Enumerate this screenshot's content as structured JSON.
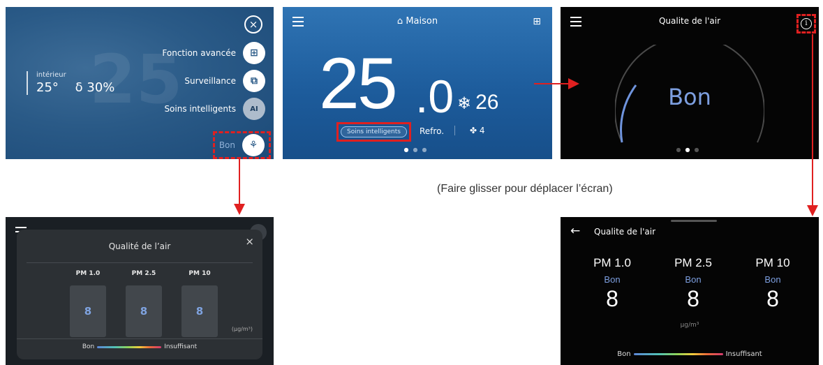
{
  "caption": "(Faire glisser pour déplacer l’écran)",
  "colors": {
    "annotation_red": "#e02020",
    "quality_blue": "#7d9fe0",
    "home_blue": "#1d5c9c"
  },
  "menu_screen": {
    "close_icon": "close-icon",
    "indoor_label": "intérieur",
    "indoor_values": "25°  δ 30%",
    "items": [
      {
        "label": "Fonction avancée",
        "icon": "grid-icon",
        "glyph": "⊞"
      },
      {
        "label": "Surveillance",
        "icon": "monitor-icon",
        "glyph": "⧉"
      },
      {
        "label": "Soins intelligents",
        "icon": "ai-icon",
        "glyph": "AI"
      },
      {
        "label": "Bon",
        "icon": "tree-icon",
        "glyph": "⚘"
      }
    ]
  },
  "home_screen": {
    "title": "Maison",
    "home_glyph": "⌂",
    "grid_glyph": "⊞",
    "temp_int": "25",
    "temp_dec": ".0",
    "set_glyph": "❄",
    "set_temp": "26",
    "smart_chip": "Soins intelligents",
    "mode": "Refro.",
    "fan_glyph": "✤",
    "fan_speed": "4"
  },
  "gauge_screen": {
    "title": "Qualite de l'air",
    "info_glyph": "i",
    "status": "Bon"
  },
  "popup_screen": {
    "title": "Qualité de l’air",
    "close_glyph": "×",
    "columns": [
      {
        "label": "PM 1.0",
        "value": "8"
      },
      {
        "label": "PM 2.5",
        "value": "8"
      },
      {
        "label": "PM 10",
        "value": "8"
      }
    ],
    "unit": "(µg/m³)",
    "scale_low": "Bon",
    "scale_high": "Insuffisant"
  },
  "detail_screen": {
    "back_glyph": "←",
    "title": "Qualite de l'air",
    "columns": [
      {
        "label": "PM 1.0",
        "quality": "Bon",
        "value": "8"
      },
      {
        "label": "PM 2.5",
        "quality": "Bon",
        "value": "8"
      },
      {
        "label": "PM 10",
        "quality": "Bon",
        "value": "8"
      }
    ],
    "unit": "µg/m³",
    "scale_low": "Bon",
    "scale_high": "Insuffisant"
  }
}
